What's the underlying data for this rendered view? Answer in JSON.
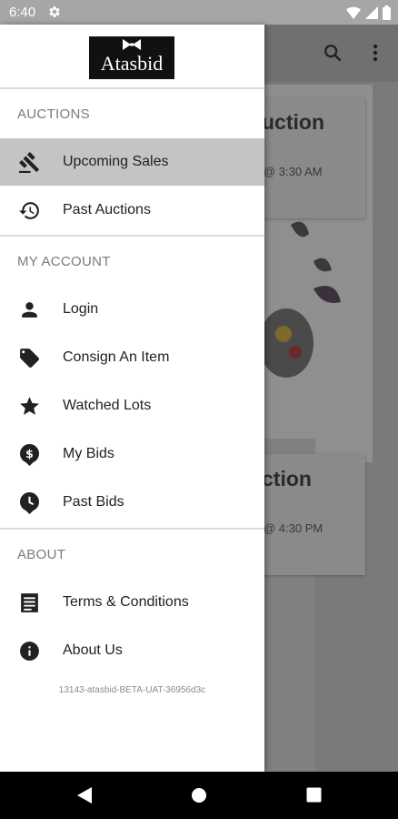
{
  "status_bar": {
    "time": "6:40"
  },
  "drawer": {
    "logo_text": "Atasbid",
    "sections": [
      {
        "title": "AUCTIONS"
      },
      {
        "title": "MY ACCOUNT"
      },
      {
        "title": "ABOUT"
      }
    ],
    "items": [
      {
        "label": "Upcoming Sales",
        "icon": "gavel-icon",
        "active": true
      },
      {
        "label": "Past Auctions",
        "icon": "history-icon"
      },
      {
        "label": "Login",
        "icon": "person-icon"
      },
      {
        "label": "Consign An Item",
        "icon": "tag-icon"
      },
      {
        "label": "Watched Lots",
        "icon": "star-icon"
      },
      {
        "label": "My Bids",
        "icon": "dollar-pin-icon"
      },
      {
        "label": "Past Bids",
        "icon": "clock-pin-icon"
      },
      {
        "label": "Terms & Conditions",
        "icon": "document-icon"
      },
      {
        "label": "About Us",
        "icon": "info-icon"
      }
    ],
    "build_id": "13143-atasbid-BETA-UAT-36956d3c"
  },
  "background": {
    "cards": [
      {
        "title": "uction",
        "time": "@ 3:30 AM"
      },
      {
        "title": "ction",
        "time": "@ 4:30 PM"
      }
    ]
  },
  "colors": {
    "active_item": "#c4c4c4",
    "scrim": "#7a7a7a",
    "nav_bar": "#000000"
  }
}
